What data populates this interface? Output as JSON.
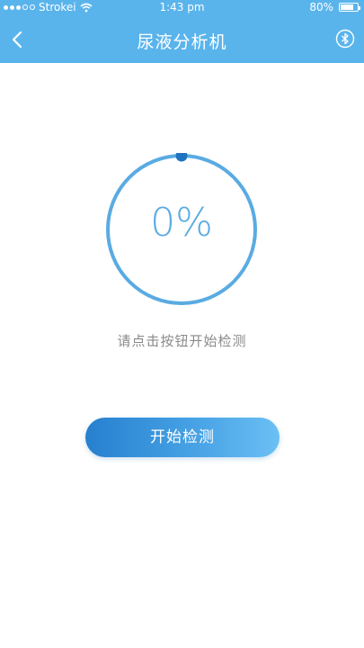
{
  "status_bar": {
    "carrier": "Strokei",
    "time": "1:43 pm",
    "battery_text": "80%",
    "battery_level": 0.8,
    "signal_bars_filled": 3,
    "signal_bars_total": 5
  },
  "navbar": {
    "title": "尿液分析机",
    "back_icon": "chevron-left-icon",
    "bluetooth_icon": "bluetooth-icon"
  },
  "progress": {
    "value": 0,
    "label": "0%"
  },
  "hint": "请点击按钮开始检测",
  "actions": {
    "start_label": "开始检测"
  },
  "colors": {
    "header": "#5ab4ec",
    "ring": "#5aabe2",
    "knob": "#1f74c2",
    "hint_text": "#8a8a8a"
  }
}
